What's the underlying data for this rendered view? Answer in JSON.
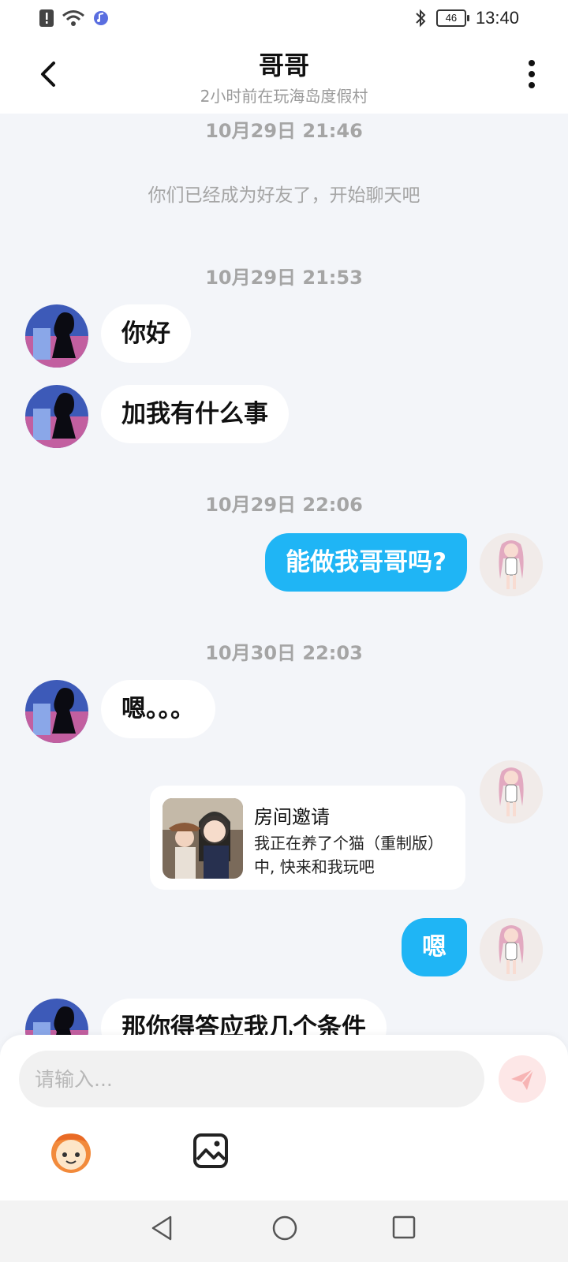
{
  "status_bar": {
    "time": "13:40",
    "battery": "46"
  },
  "header": {
    "title": "哥哥",
    "subtitle": "2小时前在玩海岛度假村"
  },
  "messages": {
    "ts1": "10月29日 21:46",
    "system": "你们已经成为好友了，开始聊天吧",
    "ts2": "10月29日 21:53",
    "m1": "你好",
    "m2": "加我有什么事",
    "ts3": "10月29日 22:06",
    "m3": "能做我哥哥吗?",
    "ts4": "10月30日 22:03",
    "m4": "嗯。。。",
    "invite_title": "房间邀请",
    "invite_desc": "我正在养了个猫（重制版）中, 快来和我玩吧",
    "m5": "嗯",
    "m6": "那你得答应我几个条件"
  },
  "composer": {
    "placeholder": "请输入..."
  },
  "colors": {
    "accent": "#1fb5f5",
    "background": "#f3f5f9",
    "send_bg": "#fde7e7"
  },
  "icons": [
    "back-arrow-icon",
    "more-vertical-icon",
    "send-icon",
    "emoji-icon",
    "image-icon",
    "nav-back-icon",
    "nav-home-icon",
    "nav-recent-icon"
  ]
}
